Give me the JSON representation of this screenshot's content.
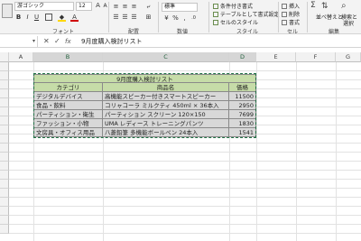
{
  "ribbon": {
    "font_name": "游ゴシック",
    "font_size": "12",
    "groups": {
      "font": "フォント",
      "alignment": "配置",
      "number": "数値",
      "styles": "スタイル",
      "cells": "セル",
      "editing": "編集"
    },
    "number_format": "標準",
    "styles_items": [
      "条件付き書式",
      "テーブルとして書式設定",
      "セルのスタイル"
    ],
    "cells_items": [
      "挿入",
      "削除",
      "書式"
    ],
    "editing_items": [
      "並べ替えと",
      "検索と",
      "選択"
    ]
  },
  "formula_bar": {
    "name_box": "",
    "fx": "fx",
    "content": "9月度購入検討リスト"
  },
  "columns": [
    "A",
    "B",
    "C",
    "D",
    "E",
    "F",
    "G"
  ],
  "selected_columns": [
    "B",
    "C",
    "D"
  ],
  "table": {
    "title": "9月度購入検討リスト",
    "headers": [
      "カテゴリ",
      "商品名",
      "価格"
    ],
    "rows": [
      [
        "デジタルデバイス",
        "高機能スピーカー付きスマートスピーカー",
        "11500"
      ],
      [
        "食品・飲料",
        "コリャコーラ ミルクティ 450ml × 36本入",
        "2950"
      ],
      [
        "パーティション・衛生",
        "パーティション スクリーン 120×150",
        "7699"
      ],
      [
        "ファッション・小物",
        "UMA レディース トレーニングパンツ",
        "1830"
      ],
      [
        "文房具・オフィス用品",
        "八菱鉛筆 多機能ボールペン 24本入",
        "1541"
      ]
    ]
  }
}
